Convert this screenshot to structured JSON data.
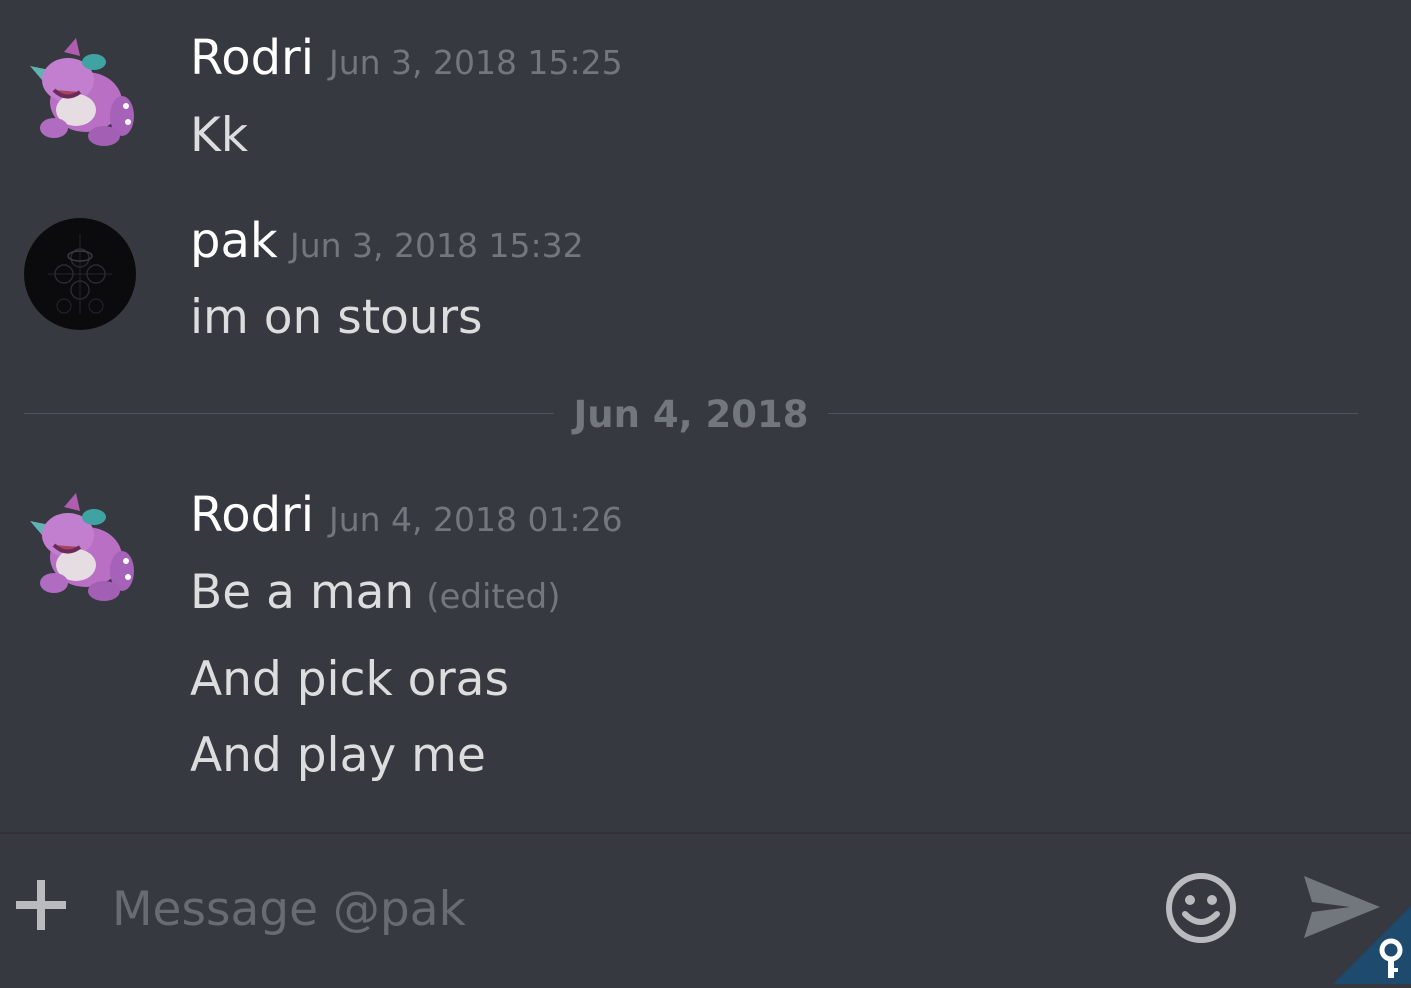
{
  "messages": [
    {
      "author": "Rodri",
      "timestamp": "Jun 3, 2018 15:25",
      "lines": [
        "Kk"
      ],
      "avatar": "nidoking-avatar"
    },
    {
      "author": "pak",
      "timestamp": "Jun 3, 2018 15:32",
      "lines": [
        "im on stours"
      ],
      "avatar": "dark-emblem-avatar"
    },
    {
      "author": "Rodri",
      "timestamp": "Jun 4, 2018 01:26",
      "lines": [
        "Be a man",
        "And pick oras",
        "And play me"
      ],
      "edited_label": "(edited)",
      "avatar": "nidoking-avatar"
    }
  ],
  "date_divider": "Jun 4, 2018",
  "composer": {
    "placeholder": "Message @pak",
    "icons": [
      "plus-icon",
      "emoji-icon",
      "send-icon",
      "key-icon"
    ]
  },
  "colors": {
    "background": "#36393f",
    "username": "#ffffff",
    "message_text": "#dcddde",
    "muted": "#72767d",
    "corner_badge": "#1e4a6e"
  }
}
